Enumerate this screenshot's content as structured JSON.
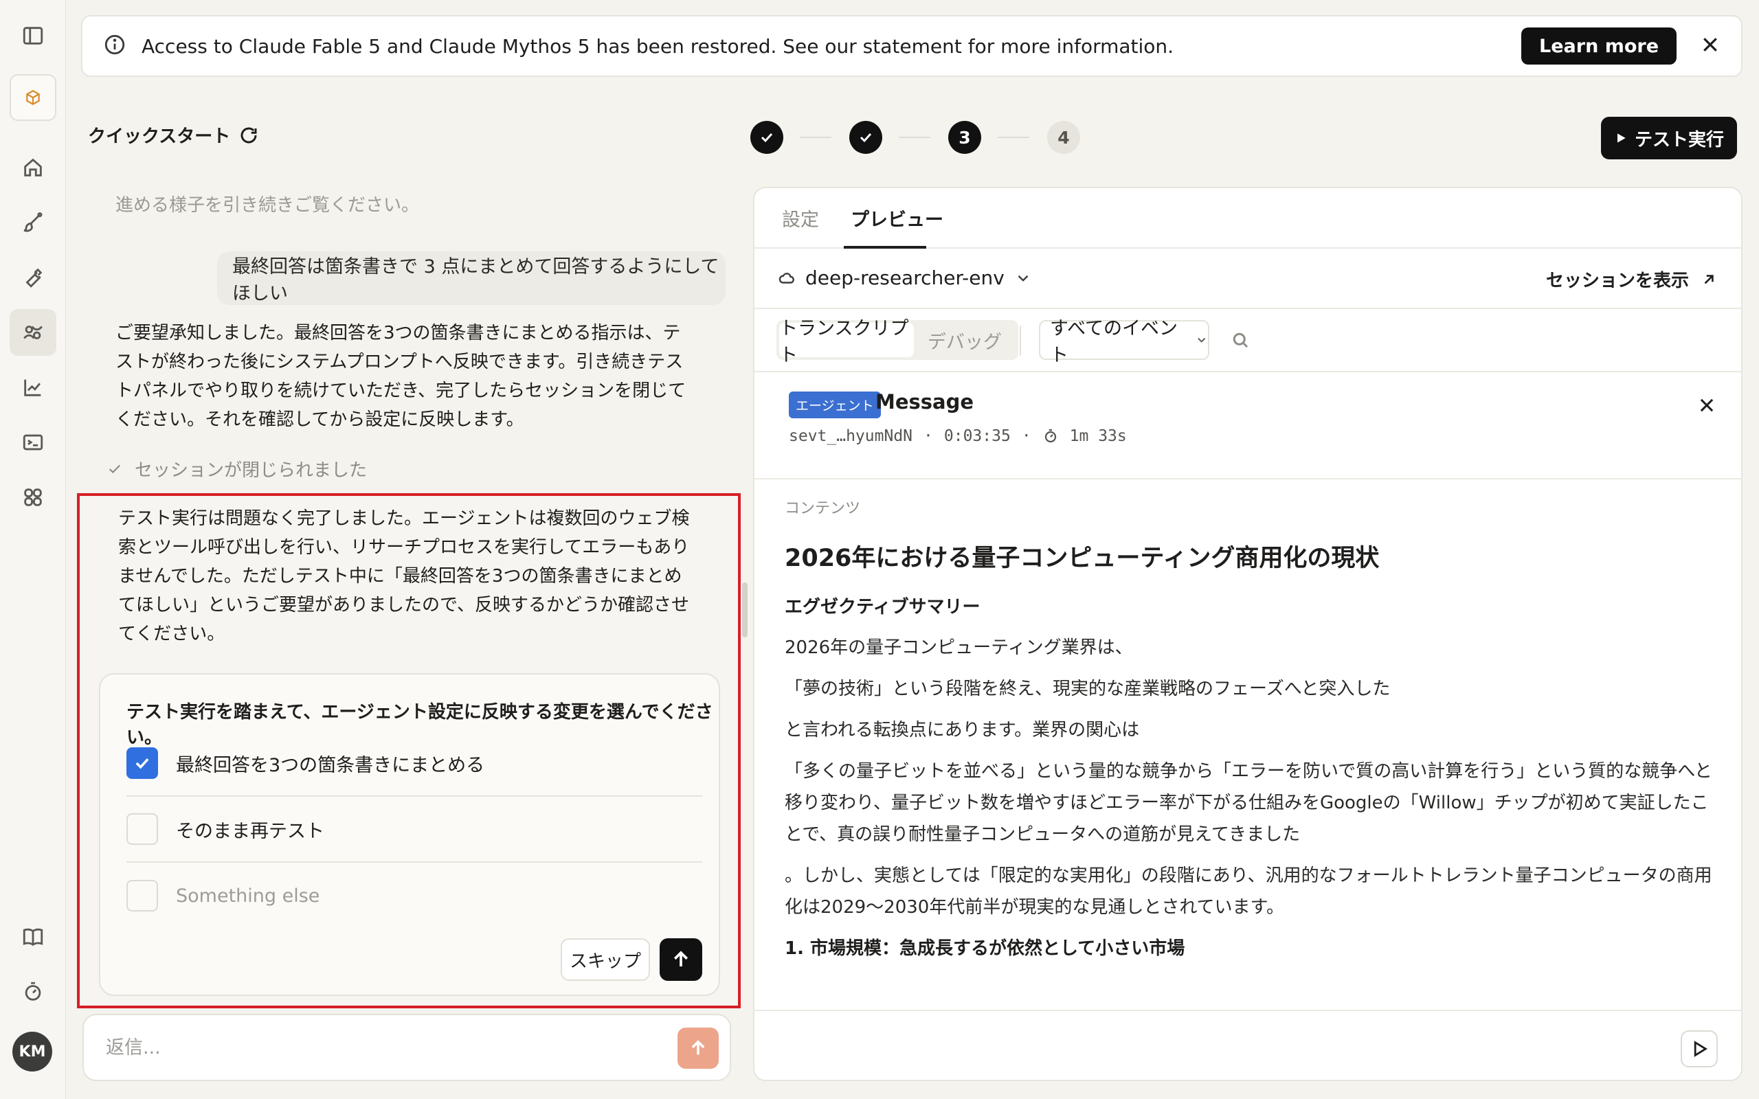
{
  "banner": {
    "text": "Access to Claude Fable 5 and Claude Mythos 5 has been restored. See our statement for more information.",
    "learn_more": "Learn more"
  },
  "sidebar": {
    "icons": [
      "sidebar-toggle-icon",
      "project-cube-icon",
      "home-icon",
      "brush-icon",
      "wrench-icon",
      "agent-icon",
      "chart-icon",
      "terminal-icon",
      "apps-icon",
      "book-icon",
      "timer-icon"
    ],
    "avatar": "KM"
  },
  "quickstart": {
    "title": "クイックスタート",
    "faded_text": "進める様子を引き続きご覧ください。",
    "user_message": "最終回答は箇条書きで 3 点にまとめて回答するようにしてほしい",
    "assistant_message": "ご要望承知しました。最終回答を3つの箇条書きにまとめる指示は、テストが終わった後にシステムプロンプトへ反映できます。引き続きテストパネルでやり取りを続けていただき、完了したらセッションを閉じてください。それを確認してから設定に反映します。",
    "session_closed": "セッションが閉じられました",
    "result_message": "テスト実行は問題なく完了しました。エージェントは複数回のウェブ検索とツール呼び出しを行い、リサーチプロセスを実行してエラーもありませんでした。ただしテスト中に「最終回答を3つの箇条書きにまとめてほしい」というご要望がありましたので、反映するかどうか確認させてください。",
    "question": "テスト実行を踏まえて、エージェント設定に反映する変更を選んでください。",
    "options": [
      {
        "label": "最終回答を3つの箇条書きにまとめる",
        "checked": true
      },
      {
        "label": "そのまま再テスト",
        "checked": false
      },
      {
        "label": "Something else",
        "checked": false
      }
    ],
    "skip_label": "スキップ",
    "reply_placeholder": "返信..."
  },
  "stepper": {
    "steps": [
      {
        "label": "",
        "state": "done"
      },
      {
        "label": "",
        "state": "done"
      },
      {
        "label": "3",
        "state": "current"
      },
      {
        "label": "4",
        "state": "pending"
      }
    ],
    "test_run_label": "テスト実行"
  },
  "preview": {
    "tabs": [
      {
        "label": "設定",
        "active": false
      },
      {
        "label": "プレビュー",
        "active": true
      }
    ],
    "env_name": "deep-researcher-env",
    "view_session": "セッションを表示",
    "segments": [
      "トランスクリプト",
      "デバッグ"
    ],
    "event_filter": "すべてのイベント",
    "message": {
      "badge": "エージェント",
      "title": "Message",
      "id": "sevt_…hyumNdN",
      "time": "0:03:35",
      "duration": "1m 33s"
    },
    "content": {
      "label": "コンテンツ",
      "heading": "2026年における量子コンピューティング商用化の現状",
      "subheading": "エグゼクティブサマリー",
      "paragraphs": [
        "2026年の量子コンピューティング業界は、",
        "「夢の技術」という段階を終え、現実的な産業戦略のフェーズへと突入した",
        "と言われる転換点にあります。業界の関心は",
        "「多くの量子ビットを並べる」という量的な競争から「エラーを防いで質の高い計算を行う」という質的な競争へと移り変わり、量子ビット数を増やすほどエラー率が下がる仕組みをGoogleの「Willow」チップが初めて実証したことで、真の誤り耐性量子コンピュータへの道筋が見えてきました",
        "。しかし、実態としては「限定的な実用化」の段階にあり、汎用的なフォールトトレラント量子コンピュータの商用化は2029〜2030年代前半が現実的な見通しとされています。"
      ],
      "section": "1. 市場規模：急成長するが依然として小さい市場"
    }
  }
}
